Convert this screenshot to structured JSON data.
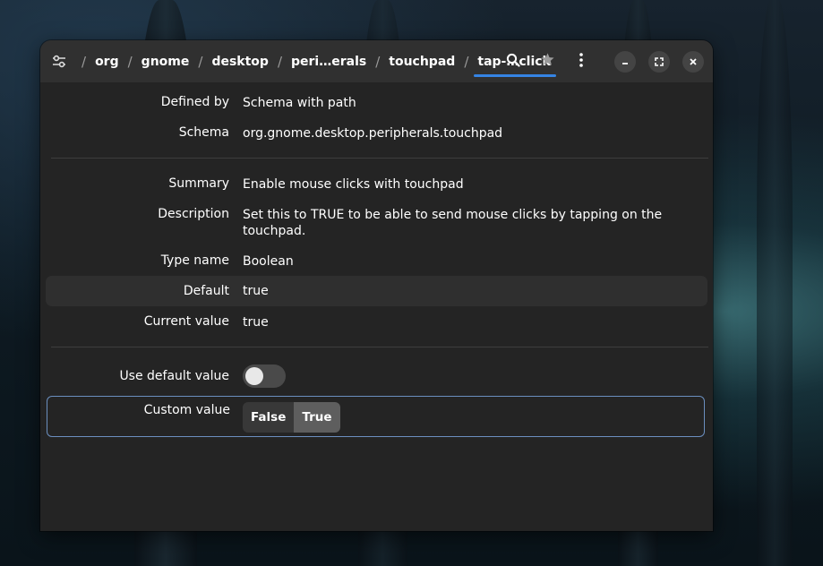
{
  "header": {
    "breadcrumbs": [
      "org",
      "gnome",
      "desktop",
      "peri…erals",
      "touchpad",
      "tap-…click"
    ]
  },
  "details": {
    "defined_by_label": "Defined by",
    "defined_by_value": "Schema with path",
    "schema_label": "Schema",
    "schema_value": "org.gnome.desktop.peripherals.touchpad",
    "summary_label": "Summary",
    "summary_value": "Enable mouse clicks with touchpad",
    "description_label": "Description",
    "description_value": "Set this to TRUE to be able to send mouse clicks by tapping on the touchpad.",
    "type_label": "Type name",
    "type_value": "Boolean",
    "default_label": "Default",
    "default_value": "true",
    "current_label": "Current value",
    "current_value": "true"
  },
  "settings": {
    "use_default_label": "Use default value",
    "use_default_on": false,
    "custom_label": "Custom value",
    "options": [
      "False",
      "True"
    ],
    "selected": "True"
  },
  "colors": {
    "accent": "#3584e4",
    "window_bg": "#242424",
    "headerbar_bg": "#303030",
    "custom_row_border": "#6b8fbf"
  },
  "icons": [
    "settings-icon",
    "search-icon",
    "star-icon",
    "menu-icon",
    "minimize-icon",
    "maximize-icon",
    "close-icon"
  ]
}
